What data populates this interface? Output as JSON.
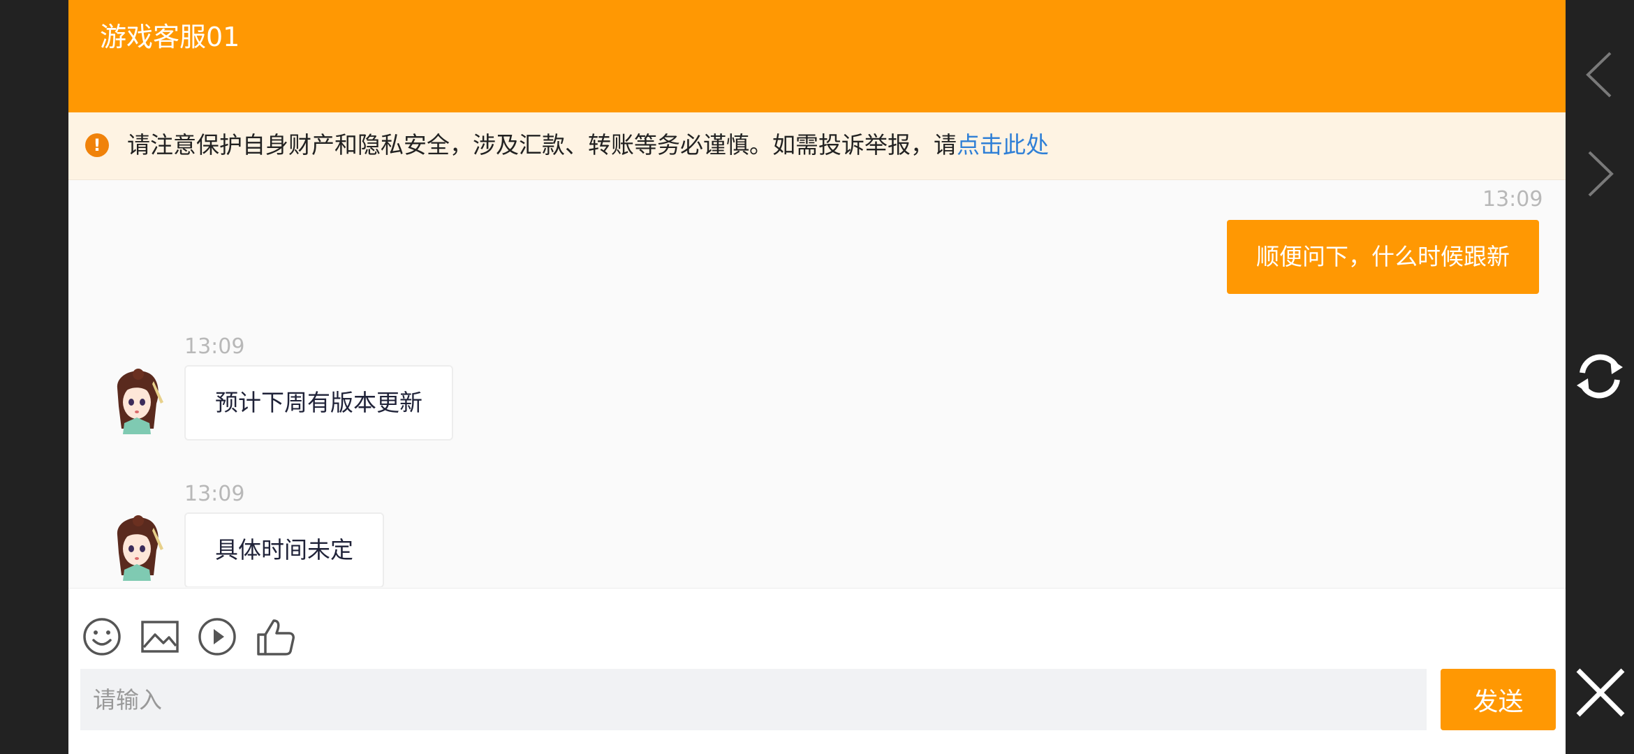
{
  "header": {
    "title": "游戏客服01"
  },
  "notice": {
    "icon": "alert-circle-icon",
    "text": "请注意保护自身财产和隐私安全，涉及汇款、转账等务必谨慎。如需投诉举报，请",
    "link": "点击此处"
  },
  "messages": [
    {
      "direction": "outgoing",
      "time": "13:09",
      "text": "顺便问下，什么时候跟新"
    },
    {
      "direction": "incoming",
      "time": "13:09",
      "text": "预计下周有版本更新",
      "avatar": "agent-avatar"
    },
    {
      "direction": "incoming",
      "time": "13:09",
      "text": "具体时间未定",
      "avatar": "agent-avatar"
    }
  ],
  "toolbar": {
    "icons": [
      "emoji-icon",
      "image-icon",
      "play-icon",
      "thumbs-up-icon"
    ]
  },
  "input": {
    "placeholder": "请输入",
    "send_label": "发送"
  },
  "side_rail": {
    "icons": [
      "chevron-left-icon",
      "chevron-right-icon",
      "refresh-icon",
      "close-icon"
    ]
  },
  "colors": {
    "accent": "#ff9803",
    "notice_bg": "#fef3e3",
    "link": "#2f7fd6",
    "chrome": "#222222"
  }
}
